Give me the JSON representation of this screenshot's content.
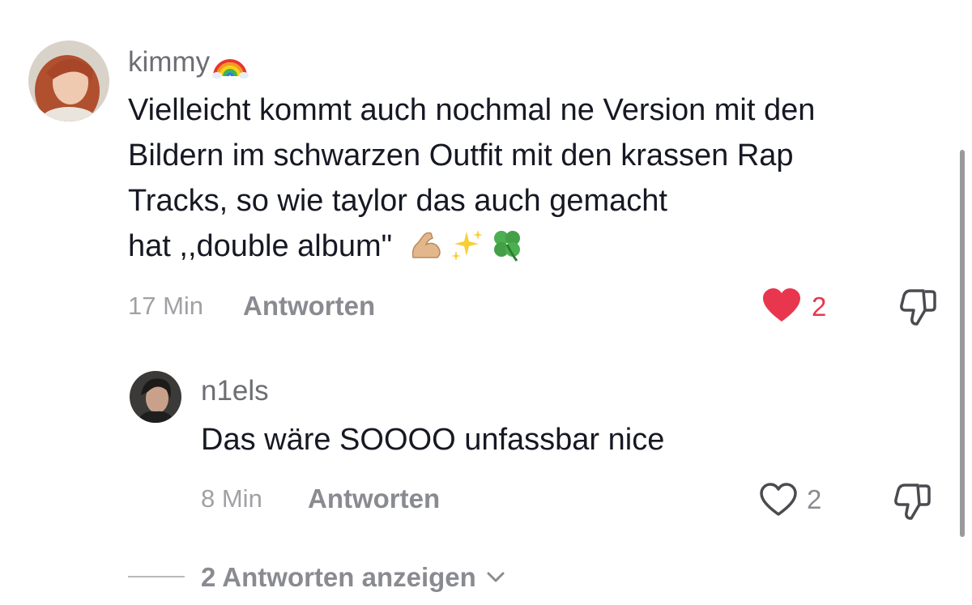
{
  "comments": [
    {
      "username": "kimmy",
      "username_emoji": "rainbow-icon",
      "text_lines": [
        "Vielleicht kommt auch nochmal ne Version mit den",
        "Bildern im schwarzen Outfit mit den krassen Rap",
        "Tracks, so wie taylor das auch gemacht",
        "hat ,,double album\""
      ],
      "text_emojis": [
        "flexed-biceps-icon",
        "sparkles-icon",
        "four-leaf-clover-icon"
      ],
      "time": "17 Min",
      "reply_label": "Antworten",
      "like_count": "2",
      "liked": true
    },
    {
      "username": "n1els",
      "text_lines": [
        "Das wäre SOOOO unfassbar nice"
      ],
      "time": "8 Min",
      "reply_label": "Antworten",
      "like_count": "2",
      "liked": false
    }
  ],
  "show_replies_label": "2 Antworten anzeigen",
  "colors": {
    "like_active": "#e8364f",
    "text": "#161823",
    "muted": "#8a8b91"
  }
}
